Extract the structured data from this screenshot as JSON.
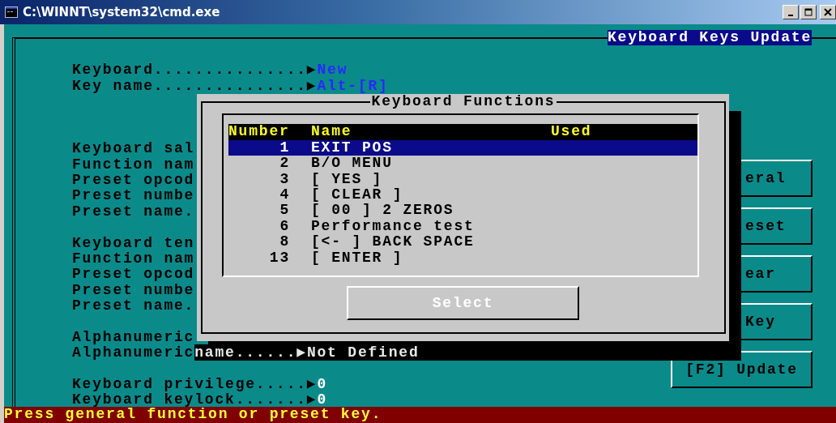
{
  "window": {
    "title": "C:\\WINNT\\system32\\cmd.exe"
  },
  "screen_title": "Keyboard Keys Update",
  "field_groups": [
    [
      {
        "kind": "value",
        "label": "Keyboard...............▶",
        "value": "New",
        "color": "#2828ff"
      },
      {
        "kind": "value",
        "label": "Key name...............▶",
        "value": "Alt-[R]",
        "color": "#2828ff"
      }
    ],
    [
      {
        "kind": "plain",
        "label": "Keyboard sal"
      },
      {
        "kind": "plain",
        "label": "Function nam"
      },
      {
        "kind": "plain",
        "label": "Preset opcod"
      },
      {
        "kind": "plain",
        "label": "Preset numbe"
      },
      {
        "kind": "plain",
        "label": "Preset name."
      }
    ],
    [
      {
        "kind": "plain",
        "label": "Keyboard ten"
      },
      {
        "kind": "plain",
        "label": "Function nam"
      },
      {
        "kind": "plain",
        "label": "Preset opcod"
      },
      {
        "kind": "plain",
        "label": "Preset numbe"
      },
      {
        "kind": "plain",
        "label": "Preset name."
      }
    ],
    [
      {
        "kind": "plain",
        "label": "Alphanumeric"
      },
      {
        "kind": "shadowed",
        "label": "Alphanumeric",
        "value": "name......▶Not Defined"
      }
    ],
    [
      {
        "kind": "value",
        "label": "Keyboard privilege.....▶",
        "value": "0",
        "color": "#ffffff"
      },
      {
        "kind": "value",
        "label": "Keyboard keylock.......▶",
        "value": "0",
        "color": "#ffffff"
      }
    ]
  ],
  "side_buttons": [
    {
      "kind": "partial",
      "label": "eral"
    },
    {
      "kind": "partial",
      "label": "eset"
    },
    {
      "kind": "partial",
      "label": "ear"
    },
    {
      "kind": "partial",
      "label": "Key"
    },
    {
      "kind": "full",
      "label": "[F2] Update"
    }
  ],
  "dialog": {
    "title": "Keyboard Functions",
    "columns": [
      "Number",
      "Name",
      "Used"
    ],
    "rows": [
      {
        "number": "1",
        "name": "EXIT POS",
        "selected": true
      },
      {
        "number": "2",
        "name": "B/O MENU",
        "selected": false
      },
      {
        "number": "3",
        "name": "[ YES ]",
        "selected": false
      },
      {
        "number": "4",
        "name": "[ CLEAR ]",
        "selected": false
      },
      {
        "number": "5",
        "name": "[ 00 ] 2 ZEROS",
        "selected": false
      },
      {
        "number": "6",
        "name": "Performance test",
        "selected": false
      },
      {
        "number": "8",
        "name": "[<- ] BACK SPACE",
        "selected": false
      },
      {
        "number": "13",
        "name": "[ ENTER ]",
        "selected": false
      }
    ],
    "button": "Select"
  },
  "status_bar": "Press general function or preset key."
}
